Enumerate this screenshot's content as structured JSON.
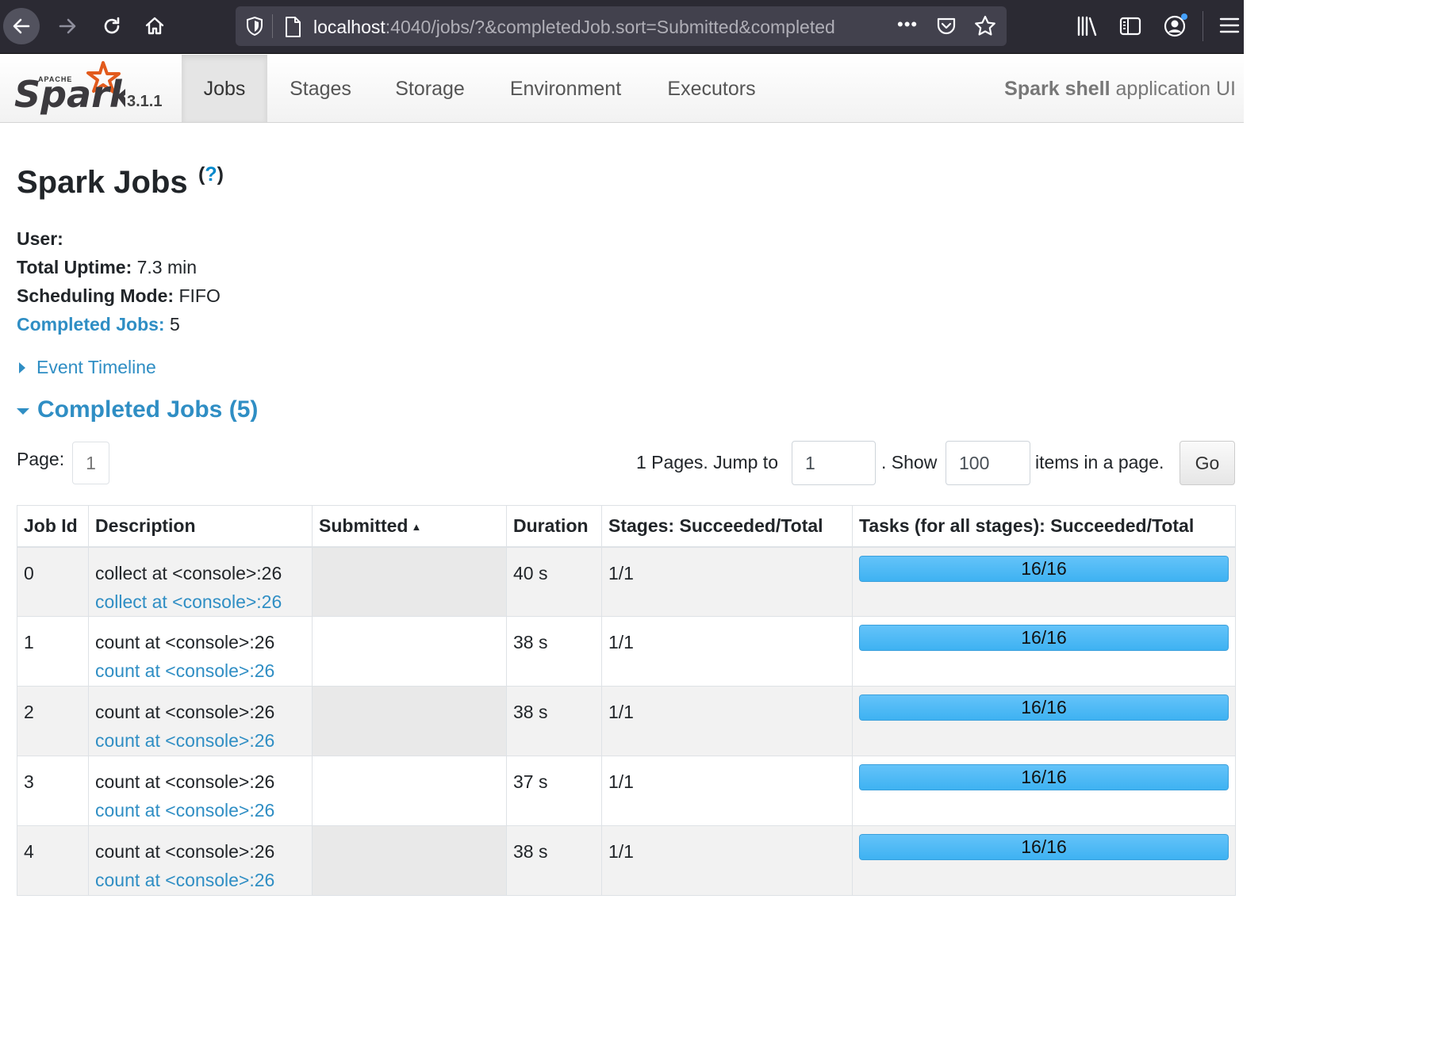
{
  "browser": {
    "url_host": "localhost",
    "url_rest": ":4040/jobs/?&completedJob.sort=Submitted&completed",
    "url_more": "•••"
  },
  "navbar": {
    "version": "3.1.1",
    "tabs": [
      {
        "label": "Jobs",
        "active": true
      },
      {
        "label": "Stages"
      },
      {
        "label": "Storage"
      },
      {
        "label": "Environment"
      },
      {
        "label": "Executors"
      }
    ],
    "app_name": "Spark shell",
    "app_suffix": " application UI"
  },
  "page": {
    "title": "Spark Jobs",
    "help_open": "(",
    "help_q": "?",
    "help_close": ")"
  },
  "summary": {
    "user_label": "User:",
    "user_value": "",
    "uptime_label": "Total Uptime:",
    "uptime_value": " 7.3 min",
    "scheduling_label": "Scheduling Mode:",
    "scheduling_value": " FIFO",
    "completed_label": "Completed Jobs:",
    "completed_value": " 5"
  },
  "event_timeline": "Event Timeline",
  "completed_section": "Completed Jobs (5)",
  "pagination": {
    "page_label": "Page:",
    "current_page": "1",
    "pages_text": "1 Pages. Jump to",
    "jump_value": "1",
    "show_text": ". Show",
    "show_value": "100",
    "items_text": "items in a page.",
    "go_label": "Go"
  },
  "table": {
    "headers": {
      "job_id": "Job Id",
      "description": "Description",
      "submitted": "Submitted",
      "sort_indicator": "▲",
      "duration": "Duration",
      "stages": "Stages: Succeeded/Total",
      "tasks": "Tasks (for all stages): Succeeded/Total"
    },
    "rows": [
      {
        "job_id": "0",
        "desc": "collect at <console>:26",
        "desc_link": "collect at <console>:26",
        "submitted": "",
        "duration": "40 s",
        "stages": "1/1",
        "tasks": "16/16",
        "progress": 1.0
      },
      {
        "job_id": "1",
        "desc": "count at <console>:26",
        "desc_link": "count at <console>:26",
        "submitted": "",
        "duration": "38 s",
        "stages": "1/1",
        "tasks": "16/16",
        "progress": 1.0
      },
      {
        "job_id": "2",
        "desc": "count at <console>:26",
        "desc_link": "count at <console>:26",
        "submitted": "",
        "duration": "38 s",
        "stages": "1/1",
        "tasks": "16/16",
        "progress": 1.0
      },
      {
        "job_id": "3",
        "desc": "count at <console>:26",
        "desc_link": "count at <console>:26",
        "submitted": "",
        "duration": "37 s",
        "stages": "1/1",
        "tasks": "16/16",
        "progress": 1.0
      },
      {
        "job_id": "4",
        "desc": "count at <console>:26",
        "desc_link": "count at <console>:26",
        "submitted": "",
        "duration": "38 s",
        "stages": "1/1",
        "tasks": "16/16",
        "progress": 1.0
      }
    ]
  },
  "colors": {
    "link": "#2f8ec4",
    "progress_fill": "#4ab8f5",
    "spark_orange": "#e25a1c"
  },
  "icons": {
    "back": "arrow-left-icon",
    "forward": "arrow-right-icon",
    "reload": "reload-icon",
    "home": "home-icon",
    "shield": "shield-icon",
    "page": "page-icon",
    "pocket": "pocket-icon",
    "star": "star-icon",
    "library": "library-icon",
    "sidebar": "sidebar-icon",
    "account": "account-icon",
    "menu": "hamburger-menu-icon"
  }
}
